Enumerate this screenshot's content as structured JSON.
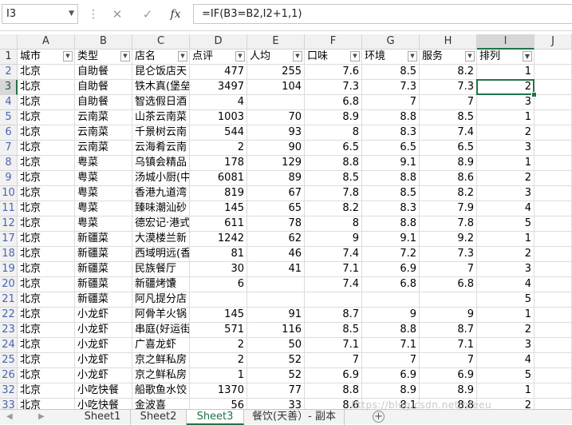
{
  "formula_bar": {
    "name_box": "I3",
    "cancel_icon": "✕",
    "enter_icon": "✓",
    "fx_label": "fx",
    "formula": "=IF(B3=B2,I2+1,1)"
  },
  "columns": [
    "A",
    "B",
    "C",
    "D",
    "E",
    "F",
    "G",
    "H",
    "I",
    "J"
  ],
  "selected_column": "I",
  "selected_row": "3",
  "header_row": {
    "row_number": "1",
    "cells": [
      "城市",
      "类型",
      "店名",
      "点评",
      "人均",
      "口味",
      "环境",
      "服务",
      "排列"
    ]
  },
  "rows": [
    {
      "n": "2",
      "c": [
        "北京",
        "自助餐",
        "昆仑饭店天",
        "477",
        "255",
        "7.6",
        "8.5",
        "8.2",
        "1"
      ]
    },
    {
      "n": "3",
      "c": [
        "北京",
        "自助餐",
        "铁木真(堡垒",
        "3497",
        "104",
        "7.3",
        "7.3",
        "7.3",
        "2"
      ]
    },
    {
      "n": "4",
      "c": [
        "北京",
        "自助餐",
        "智选假日酒",
        "4",
        "",
        "6.8",
        "7",
        "7",
        "3"
      ]
    },
    {
      "n": "5",
      "c": [
        "北京",
        "云南菜",
        "山茶云南菜",
        "1003",
        "70",
        "8.9",
        "8.8",
        "8.5",
        "1"
      ]
    },
    {
      "n": "6",
      "c": [
        "北京",
        "云南菜",
        "千景树云南",
        "544",
        "93",
        "8",
        "8.3",
        "7.4",
        "2"
      ]
    },
    {
      "n": "7",
      "c": [
        "北京",
        "云南菜",
        "云海肴云南",
        "2",
        "90",
        "6.5",
        "6.5",
        "6.5",
        "3"
      ]
    },
    {
      "n": "8",
      "c": [
        "北京",
        "粤菜",
        "乌镇会精品",
        "178",
        "129",
        "8.8",
        "9.1",
        "8.9",
        "1"
      ]
    },
    {
      "n": "9",
      "c": [
        "北京",
        "粤菜",
        "汤城小厨(中",
        "6081",
        "89",
        "8.5",
        "8.8",
        "8.6",
        "2"
      ]
    },
    {
      "n": "10",
      "c": [
        "北京",
        "粤菜",
        "香港九道湾",
        "819",
        "67",
        "7.8",
        "8.5",
        "8.2",
        "3"
      ]
    },
    {
      "n": "11",
      "c": [
        "北京",
        "粤菜",
        "臻味潮汕砂",
        "145",
        "65",
        "8.2",
        "8.3",
        "7.9",
        "4"
      ]
    },
    {
      "n": "12",
      "c": [
        "北京",
        "粤菜",
        "德宏记·港式",
        "611",
        "78",
        "8",
        "8.8",
        "7.8",
        "5"
      ]
    },
    {
      "n": "17",
      "c": [
        "北京",
        "新疆菜",
        "大漠楼兰新",
        "1242",
        "62",
        "9",
        "9.1",
        "9.2",
        "1"
      ]
    },
    {
      "n": "18",
      "c": [
        "北京",
        "新疆菜",
        "西域明远(香",
        "81",
        "46",
        "7.4",
        "7.2",
        "7.3",
        "2"
      ]
    },
    {
      "n": "19",
      "c": [
        "北京",
        "新疆菜",
        "民族餐厅",
        "30",
        "41",
        "7.1",
        "6.9",
        "7",
        "3"
      ]
    },
    {
      "n": "20",
      "c": [
        "北京",
        "新疆菜",
        "新疆烤馕",
        "6",
        "",
        "7.4",
        "6.8",
        "6.8",
        "4"
      ]
    },
    {
      "n": "21",
      "c": [
        "北京",
        "新疆菜",
        "阿凡提分店",
        "",
        "",
        "",
        "",
        "",
        "5"
      ]
    },
    {
      "n": "22",
      "c": [
        "北京",
        "小龙虾",
        "阿骨羊火锅",
        "145",
        "91",
        "8.7",
        "9",
        "9",
        "1"
      ]
    },
    {
      "n": "23",
      "c": [
        "北京",
        "小龙虾",
        "串庭(好运街",
        "571",
        "116",
        "8.5",
        "8.8",
        "8.7",
        "2"
      ]
    },
    {
      "n": "24",
      "c": [
        "北京",
        "小龙虾",
        "广喜龙虾",
        "2",
        "50",
        "7.1",
        "7.1",
        "7.1",
        "3"
      ]
    },
    {
      "n": "25",
      "c": [
        "北京",
        "小龙虾",
        "京之鲜私房",
        "2",
        "52",
        "7",
        "7",
        "7",
        "4"
      ]
    },
    {
      "n": "26",
      "c": [
        "北京",
        "小龙虾",
        "京之鲜私房",
        "1",
        "52",
        "6.9",
        "6.9",
        "6.9",
        "5"
      ]
    },
    {
      "n": "32",
      "c": [
        "北京",
        "小吃快餐",
        "船歌鱼水饺",
        "1370",
        "77",
        "8.8",
        "8.9",
        "8.9",
        "1"
      ]
    },
    {
      "n": "33",
      "c": [
        "北京",
        "小吃快餐",
        "金波喜",
        "56",
        "33",
        "8.6",
        "8.1",
        "8.8",
        "2"
      ]
    }
  ],
  "sheet_tabs": [
    "Sheet1",
    "Sheet2",
    "Sheet3",
    "餐饮(天善）- 副本"
  ],
  "active_sheet": "Sheet3",
  "watermark": "https://blog.csdn.net/hfeeu",
  "colors": {
    "accent": "#217346",
    "header_bg": "#f1f1f1",
    "selected_header_bg": "#d7d7d7",
    "row_number_text": "#4a64b4"
  }
}
